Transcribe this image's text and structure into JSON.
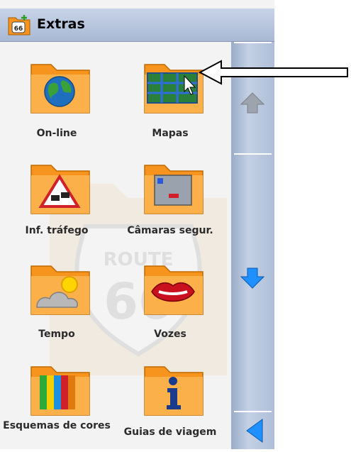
{
  "window": {
    "title": "Extras",
    "title_icon": "route66-folder-icon"
  },
  "items": [
    {
      "label": "On-line",
      "icon": "globe-folder-icon"
    },
    {
      "label": "Mapas",
      "icon": "maps-folder-icon"
    },
    {
      "label": "Inf. tráfego",
      "icon": "traffic-warning-folder-icon"
    },
    {
      "label": "Câmaras segur.",
      "icon": "speed-camera-folder-icon"
    },
    {
      "label": "Tempo",
      "icon": "weather-folder-icon"
    },
    {
      "label": "Vozes",
      "icon": "lips-folder-icon"
    },
    {
      "label": "Esquemas de cores",
      "icon": "color-schemes-folder-icon"
    },
    {
      "label": "Guias de viagem",
      "icon": "info-folder-icon"
    }
  ],
  "scrollbar": {
    "up": "up-arrow-icon",
    "down": "down-arrow-icon",
    "back": "back-arrow-icon"
  },
  "annotation": {
    "pointer": "callout-arrow-icon"
  },
  "colors": {
    "folder": "#f7941d",
    "folder_dark": "#e07a10",
    "titlebar": "#b4c2dc",
    "scroll_blue": "#1e90ff"
  }
}
